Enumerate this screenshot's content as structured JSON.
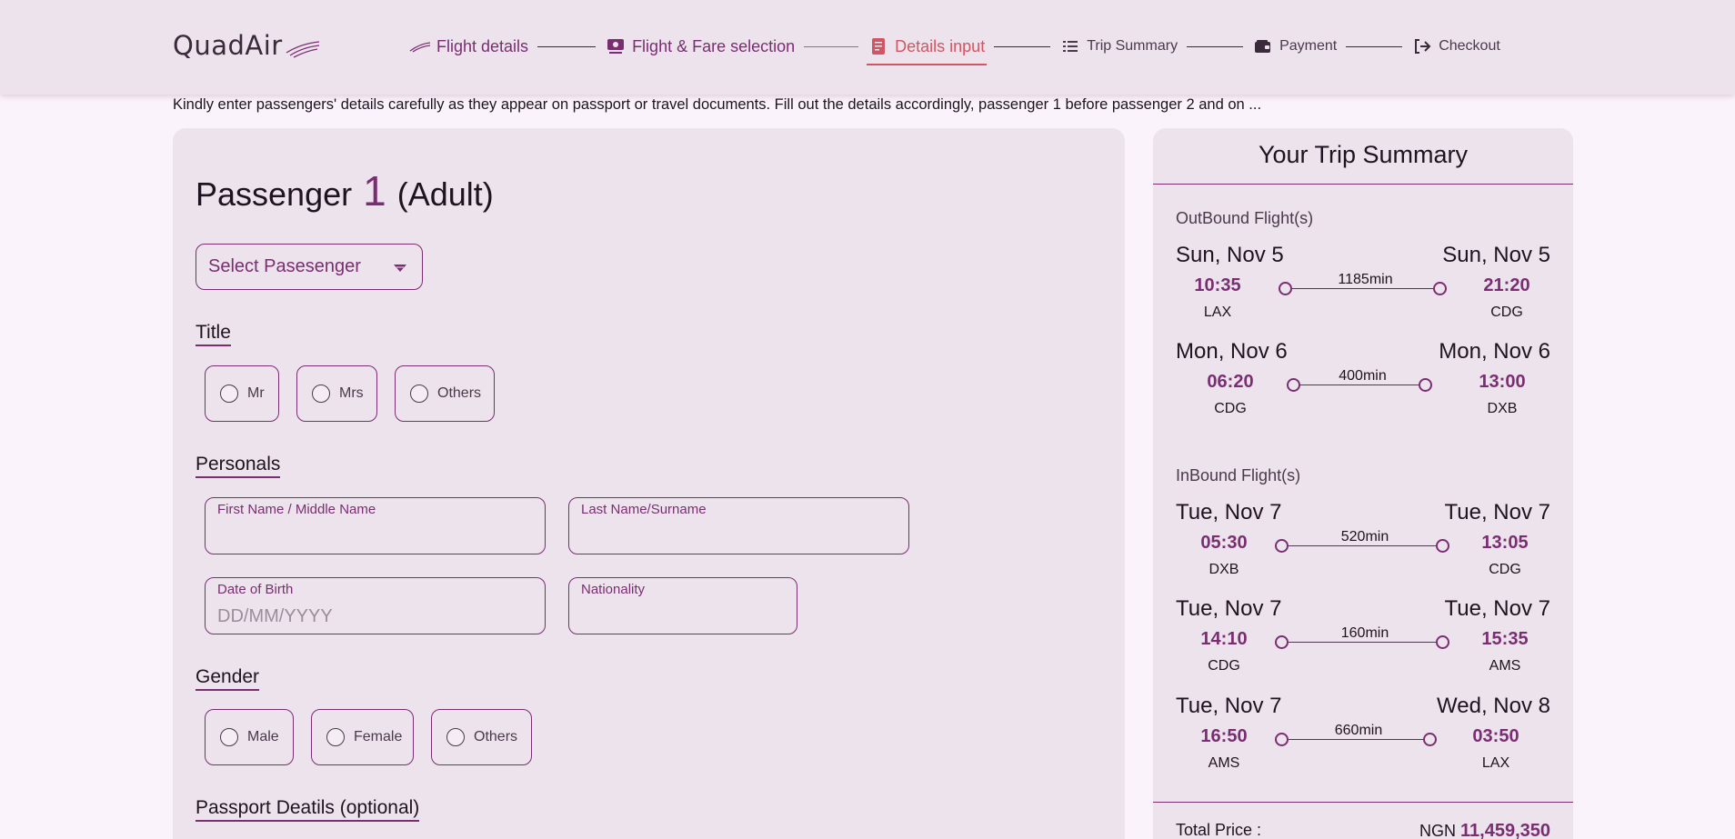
{
  "brand": {
    "logo_main": "Quad",
    "logo_air": "Air"
  },
  "steps": [
    {
      "label": "Flight details",
      "icon": "plane-wing-icon"
    },
    {
      "label": "Flight & Fare selection",
      "icon": "ticket-icon"
    },
    {
      "label": "Details input",
      "icon": "document-icon"
    },
    {
      "label": "Trip Summary",
      "icon": "list-icon"
    },
    {
      "label": "Payment",
      "icon": "wallet-icon"
    },
    {
      "label": "Checkout",
      "icon": "checkout-icon"
    }
  ],
  "intro": "Kindly enter passengers' details carefully as they appear on passport or travel documents. Fill out the details accordingly, passenger 1 before passenger 2 and on ...",
  "passenger": {
    "title_prefix": "Passenger",
    "number": "1",
    "type": "(Adult)",
    "select_label": "Select Pasesenger"
  },
  "title_section": {
    "heading": "Title",
    "options": [
      "Mr",
      "Mrs",
      "Others"
    ]
  },
  "personals": {
    "heading": "Personals",
    "first_name_label": "First Name / Middle Name",
    "last_name_label": "Last Name/Surname",
    "dob_label": "Date of Birth",
    "dob_placeholder": "DD/MM/YYYY",
    "nationality_label": "Nationality"
  },
  "gender": {
    "heading": "Gender",
    "options": [
      "Male",
      "Female",
      "Others"
    ]
  },
  "passport": {
    "heading": "Passport Deatils (optional)"
  },
  "summary": {
    "title": "Your Trip Summary",
    "outbound_label": "OutBound Flight(s)",
    "inbound_label": "InBound Flight(s)",
    "outbound": [
      {
        "dep_date": "Sun, Nov 5",
        "arr_date": "Sun, Nov 5",
        "dep_time": "10:35",
        "arr_time": "21:20",
        "from": "LAX",
        "to": "CDG",
        "duration": "1185min"
      },
      {
        "dep_date": "Mon, Nov 6",
        "arr_date": "Mon, Nov 6",
        "dep_time": "06:20",
        "arr_time": "13:00",
        "from": "CDG",
        "to": "DXB",
        "duration": "400min"
      }
    ],
    "inbound": [
      {
        "dep_date": "Tue, Nov 7",
        "arr_date": "Tue, Nov 7",
        "dep_time": "05:30",
        "arr_time": "13:05",
        "from": "DXB",
        "to": "CDG",
        "duration": "520min"
      },
      {
        "dep_date": "Tue, Nov 7",
        "arr_date": "Tue, Nov 7",
        "dep_time": "14:10",
        "arr_time": "15:35",
        "from": "CDG",
        "to": "AMS",
        "duration": "160min"
      },
      {
        "dep_date": "Tue, Nov 7",
        "arr_date": "Wed, Nov 8",
        "dep_time": "16:50",
        "arr_time": "03:50",
        "from": "AMS",
        "to": "LAX",
        "duration": "660min"
      }
    ],
    "total_label": "Total Price :",
    "currency": "NGN",
    "total_amount": "11,459,350"
  },
  "colors": {
    "accent": "#7a2e72",
    "active_step": "#d15664",
    "card": "#ede3ec",
    "page": "#fbf3fb"
  }
}
